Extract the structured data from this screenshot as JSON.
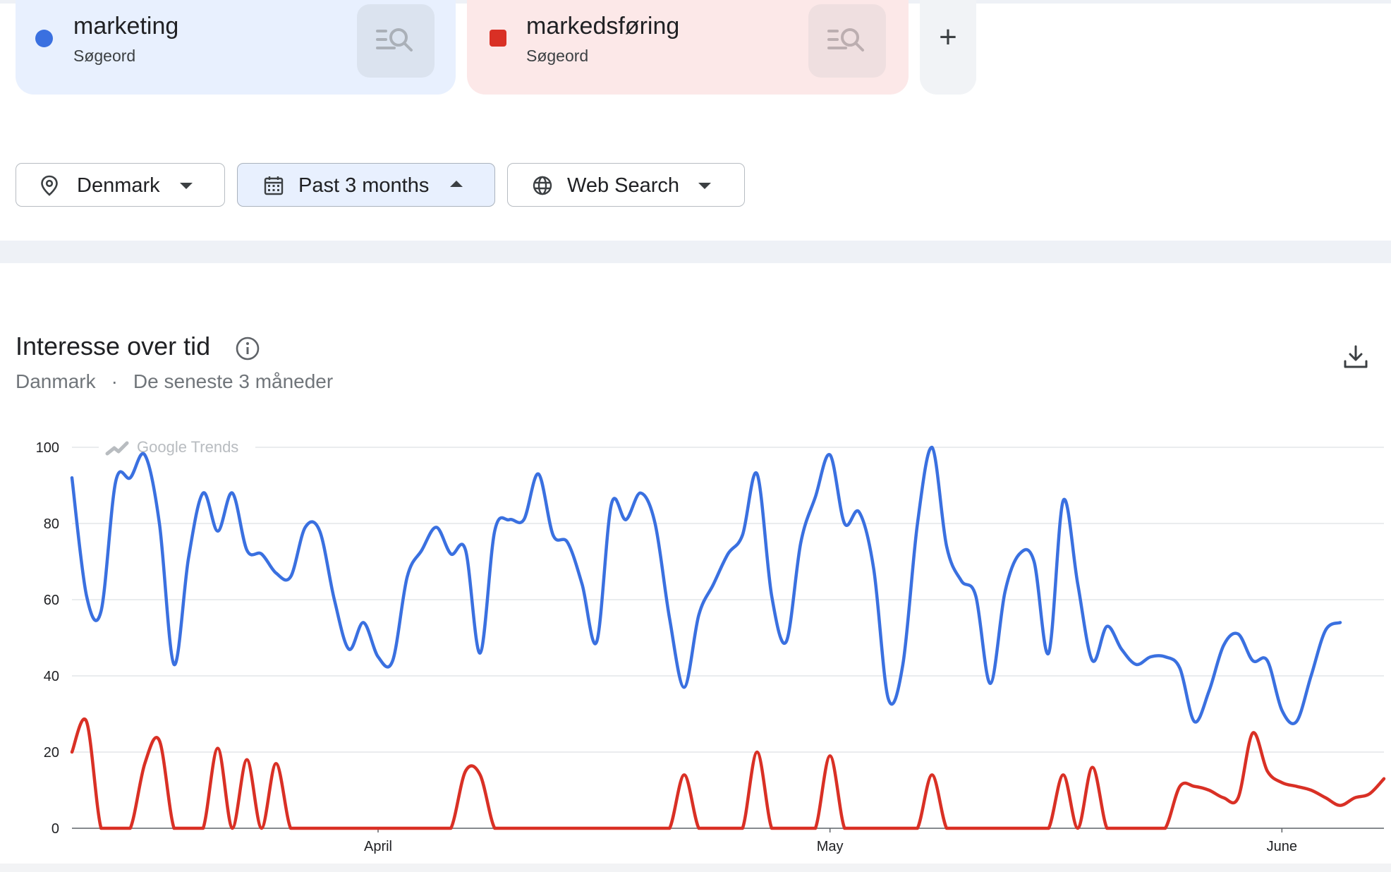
{
  "terms": [
    {
      "name": "marketing",
      "type": "Søgeord",
      "color": "#3a70e0",
      "marker": "circle"
    },
    {
      "name": "markedsføring",
      "type": "Søgeord",
      "color": "#d93025",
      "marker": "square"
    }
  ],
  "add_term_label": "+",
  "filters": {
    "geo": "Denmark",
    "time": "Past 3 months",
    "property": "Web Search"
  },
  "widget": {
    "title": "Interesse over tid",
    "geo": "Danmark",
    "separator": "·",
    "period": "De seneste 3 måneder"
  },
  "chart_data": {
    "type": "line",
    "watermark": "Google Trends",
    "ylim": [
      0,
      100
    ],
    "yticks": [
      0,
      20,
      40,
      60,
      80,
      100
    ],
    "xlim": [
      "2024-03-10",
      "2024-06-08"
    ],
    "xticks": [
      {
        "label": "April",
        "date": "2024-03-31"
      },
      {
        "label": "May",
        "date": "2024-05-01"
      },
      {
        "label": "June",
        "date": "2024-06-01"
      }
    ],
    "grid": true,
    "x": [
      "2024-03-10",
      "2024-03-11",
      "2024-03-12",
      "2024-03-13",
      "2024-03-14",
      "2024-03-15",
      "2024-03-16",
      "2024-03-17",
      "2024-03-18",
      "2024-03-19",
      "2024-03-20",
      "2024-03-21",
      "2024-03-22",
      "2024-03-23",
      "2024-03-24",
      "2024-03-25",
      "2024-03-26",
      "2024-03-27",
      "2024-03-28",
      "2024-03-29",
      "2024-03-30",
      "2024-03-31",
      "2024-04-01",
      "2024-04-02",
      "2024-04-03",
      "2024-04-04",
      "2024-04-05",
      "2024-04-06",
      "2024-04-07",
      "2024-04-08",
      "2024-04-09",
      "2024-04-10",
      "2024-04-11",
      "2024-04-12",
      "2024-04-13",
      "2024-04-14",
      "2024-04-15",
      "2024-04-16",
      "2024-04-17",
      "2024-04-18",
      "2024-04-19",
      "2024-04-20",
      "2024-04-21",
      "2024-04-22",
      "2024-04-23",
      "2024-04-24",
      "2024-04-25",
      "2024-04-26",
      "2024-04-27",
      "2024-04-28",
      "2024-04-29",
      "2024-04-30",
      "2024-05-01",
      "2024-05-02",
      "2024-05-03",
      "2024-05-04",
      "2024-05-05",
      "2024-05-06",
      "2024-05-07",
      "2024-05-08",
      "2024-05-09",
      "2024-05-10",
      "2024-05-11",
      "2024-05-12",
      "2024-05-13",
      "2024-05-14",
      "2024-05-15",
      "2024-05-16",
      "2024-05-17",
      "2024-05-18",
      "2024-05-19",
      "2024-05-20",
      "2024-05-21",
      "2024-05-22",
      "2024-05-23",
      "2024-05-24",
      "2024-05-25",
      "2024-05-26",
      "2024-05-27",
      "2024-05-28",
      "2024-05-29",
      "2024-05-30",
      "2024-05-31",
      "2024-06-01",
      "2024-06-02",
      "2024-06-03",
      "2024-06-04",
      "2024-06-05",
      "2024-06-06",
      "2024-06-07",
      "2024-06-08"
    ],
    "series": [
      {
        "name": "marketing",
        "color": "#3a70e0",
        "values": [
          92,
          61,
          57,
          91,
          92,
          98,
          80,
          43,
          71,
          88,
          78,
          88,
          73,
          72,
          67,
          66,
          79,
          78,
          60,
          47,
          54,
          45,
          44,
          66,
          73,
          79,
          72,
          73,
          46,
          78,
          81,
          81,
          93,
          77,
          75,
          64,
          49,
          85,
          81,
          88,
          80,
          55,
          37,
          56,
          64,
          72,
          77,
          93,
          61,
          49,
          75,
          87,
          98,
          80,
          83,
          68,
          34,
          43,
          80,
          100,
          74,
          65,
          61,
          38,
          62,
          72,
          70,
          46,
          86,
          64,
          44,
          53,
          47,
          43,
          45,
          45,
          42,
          28,
          36,
          48,
          51,
          44,
          44,
          31,
          28,
          40,
          52,
          54
        ]
      },
      {
        "name": "markedsføring",
        "color": "#d93025",
        "values": [
          20,
          28,
          0,
          0,
          0,
          17,
          23,
          0,
          0,
          0,
          21,
          0,
          18,
          0,
          17,
          0,
          0,
          0,
          0,
          0,
          0,
          0,
          0,
          0,
          0,
          0,
          0,
          15,
          14,
          0,
          0,
          0,
          0,
          0,
          0,
          0,
          0,
          0,
          0,
          0,
          0,
          0,
          14,
          0,
          0,
          0,
          0,
          20,
          0,
          0,
          0,
          0,
          19,
          0,
          0,
          0,
          0,
          0,
          0,
          14,
          0,
          0,
          0,
          0,
          0,
          0,
          0,
          0,
          14,
          0,
          16,
          0,
          0,
          0,
          0,
          0,
          11,
          11,
          10,
          8,
          8,
          25,
          15,
          12,
          11,
          10,
          8,
          6,
          8,
          9,
          13
        ]
      }
    ]
  }
}
